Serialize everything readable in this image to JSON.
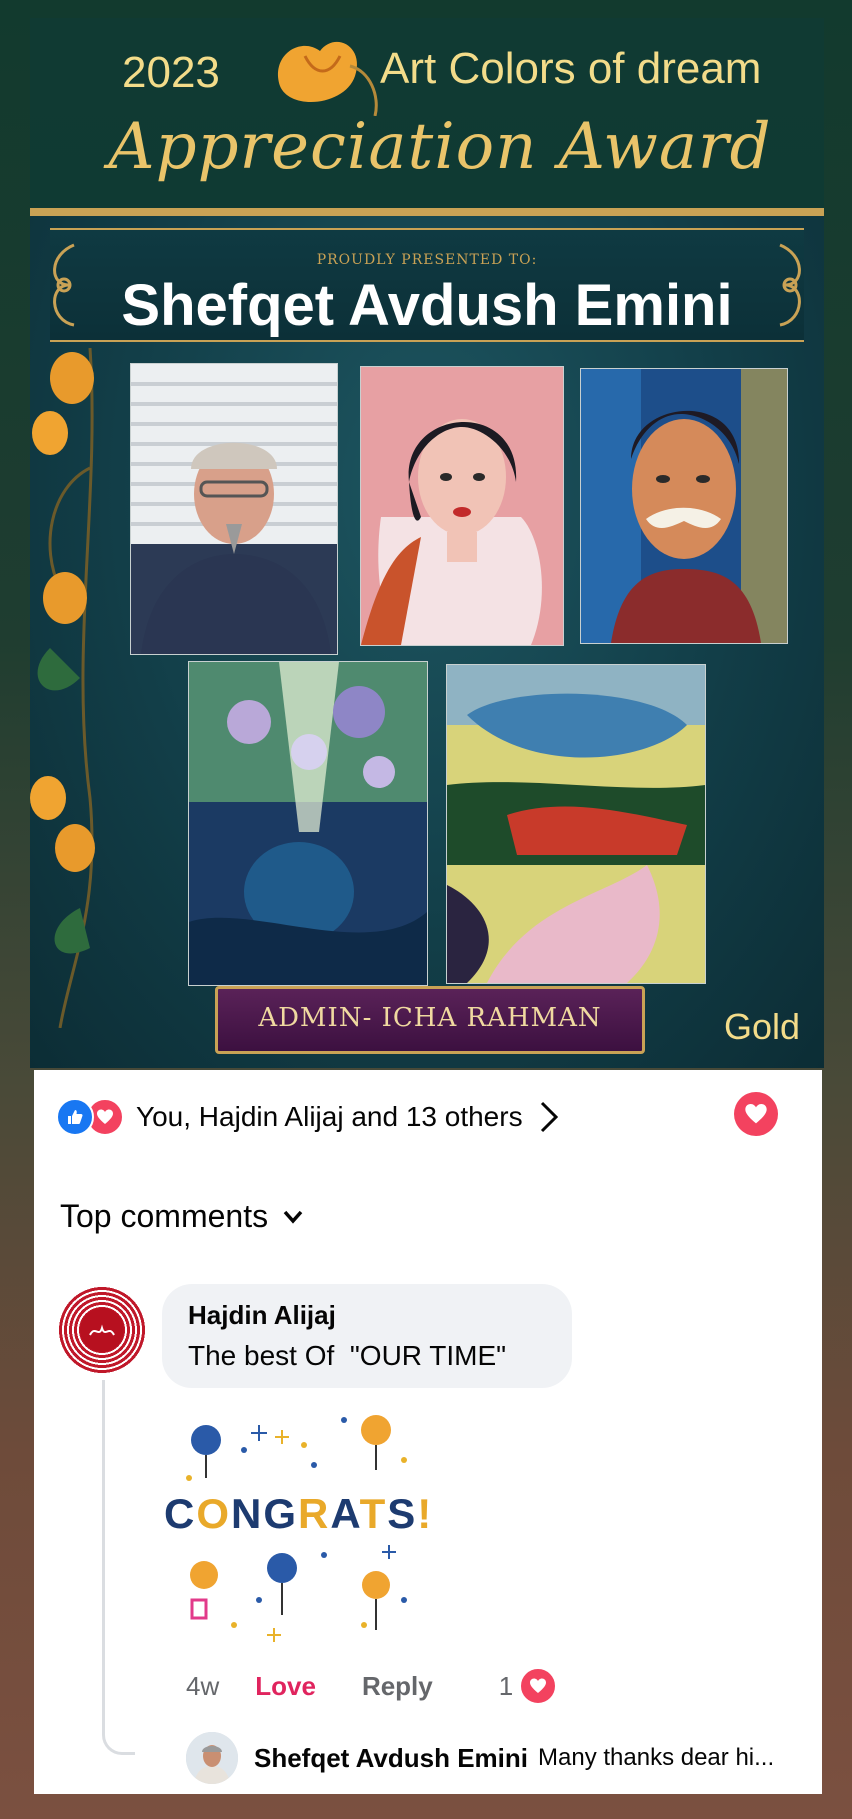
{
  "poster": {
    "year": "2023",
    "brand": "Art Colors of dream",
    "award_title": "Appreciation Award",
    "presented_label": "PROUDLY PRESENTED TO:",
    "honoree": "Shefqet Avdush Emini",
    "admin": "ADMIN- ICHA RAHMAN",
    "level": "Gold"
  },
  "post": {
    "reactions_text": "You, Hajdin Alijaj and 13 others",
    "top_comments_label": "Top comments"
  },
  "comment": {
    "author": "Hajdin Alijaj",
    "text": "The best Of  \"OUR TIME\"",
    "sticker_text": "CONGRATS!",
    "time": "4w",
    "love_label": "Love",
    "reply_label": "Reply",
    "reaction_count": "1"
  },
  "reply": {
    "author": "Shefqet Avdush Emini",
    "text": "Many thanks dear hi..."
  },
  "colors": {
    "like_blue": "#1877f2",
    "love_red": "#f3425f",
    "gold": "#c9a255"
  }
}
